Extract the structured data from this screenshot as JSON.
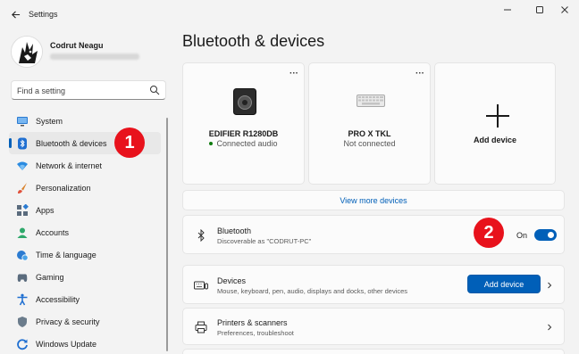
{
  "window": {
    "title": "Settings",
    "controls": [
      "minimize-icon",
      "maximize-icon",
      "close-icon"
    ]
  },
  "profile": {
    "name": "Codrut Neagu"
  },
  "search": {
    "placeholder": "Find a setting"
  },
  "sidebar": {
    "items": [
      {
        "label": "System",
        "icon": "system-icon"
      },
      {
        "label": "Bluetooth & devices",
        "icon": "bluetooth-icon",
        "selected": true
      },
      {
        "label": "Network & internet",
        "icon": "wifi-icon"
      },
      {
        "label": "Personalization",
        "icon": "brush-icon"
      },
      {
        "label": "Apps",
        "icon": "apps-icon"
      },
      {
        "label": "Accounts",
        "icon": "accounts-icon"
      },
      {
        "label": "Time & language",
        "icon": "globe-clock-icon"
      },
      {
        "label": "Gaming",
        "icon": "gamepad-icon"
      },
      {
        "label": "Accessibility",
        "icon": "accessibility-icon"
      },
      {
        "label": "Privacy & security",
        "icon": "shield-icon"
      },
      {
        "label": "Windows Update",
        "icon": "update-icon"
      }
    ]
  },
  "callouts": {
    "one": "1",
    "two": "2"
  },
  "main": {
    "title": "Bluetooth & devices",
    "devices": [
      {
        "name": "EDIFIER R1280DB",
        "status": "Connected audio",
        "connected": true,
        "icon": "speaker-icon"
      },
      {
        "name": "PRO X TKL",
        "status": "Not connected",
        "connected": false,
        "icon": "keyboard-icon"
      }
    ],
    "add_device_card": "Add device",
    "view_more": "View more devices",
    "bluetooth": {
      "title": "Bluetooth",
      "subtitle": "Discoverable as \"CODRUT-PC\"",
      "state_label": "On",
      "enabled": true
    },
    "devices_row": {
      "title": "Devices",
      "subtitle": "Mouse, keyboard, pen, audio, displays and docks, other devices",
      "button": "Add device"
    },
    "printers_row": {
      "title": "Printers & scanners",
      "subtitle": "Preferences, troubleshoot"
    }
  },
  "colors": {
    "accent": "#005fb8",
    "callout": "#e8121c",
    "connected": "#0f7b0f"
  }
}
